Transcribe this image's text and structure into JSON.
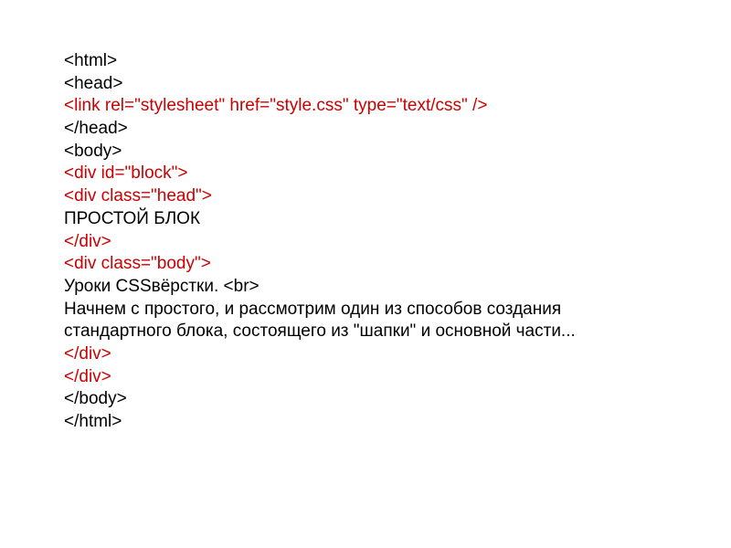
{
  "lines": {
    "l1": "<html>",
    "l2": "<head>",
    "l3": "<link rel=\"stylesheet\" href=\"style.css\" type=\"text/css\" />",
    "l4": "</head>",
    "l5": "<body>",
    "l6": "<div id=\"block\">",
    "l7": "<div class=\"head\">",
    "l8": "ПРОСТОЙ БЛОК",
    "l9": "</div>",
    "l10": "<div class=\"body\">",
    "l11": "Уроки CSSвёрстки. <br>",
    "l12": "Начнем с простого, и рассмотрим один из способов создания стандартного блока, состоящего из \"шапки\" и основной части...",
    "l13": "</div>",
    "l14": "</div>",
    "l15": "</body>",
    "l16": "</html>"
  }
}
